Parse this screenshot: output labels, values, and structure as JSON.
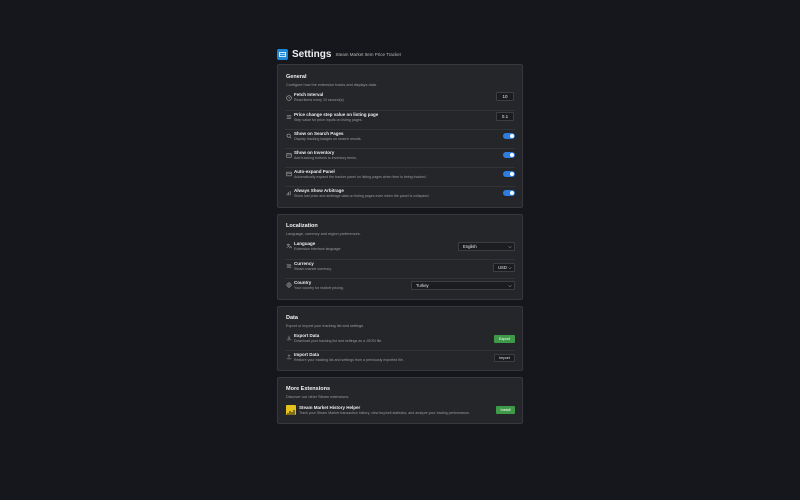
{
  "header": {
    "title": "Settings",
    "subtitle": "Steam Market Item Price Tracker"
  },
  "general": {
    "title": "General",
    "desc": "Configure how the extension tracks and displays data.",
    "rows": [
      {
        "label": "Fetch Interval",
        "desc": "Read items every 10 second(s)",
        "value": "10",
        "icon": "clock-icon"
      },
      {
        "label": "Price change step value on listing page",
        "desc": "Step value for price inputs on listing pages.",
        "value": "0.1",
        "icon": "list-icon"
      },
      {
        "label": "Show on Search Pages",
        "desc": "Display tracking badges on search results.",
        "toggle": true,
        "icon": "search-icon"
      },
      {
        "label": "Show on Inventory",
        "desc": "Add tracking buttons to inventory items.",
        "toggle": true,
        "icon": "inventory-icon"
      },
      {
        "label": "Auto-expand Panel",
        "desc": "Automatically expand the tracker panel on listing pages when item is being tracked.",
        "toggle": true,
        "icon": "panel-icon"
      },
      {
        "label": "Always Show Arbitrage",
        "desc": "Show lost price and arbitrage data on listing pages even when the panel is collapsed.",
        "toggle": true,
        "icon": "chart-icon"
      }
    ]
  },
  "localization": {
    "title": "Localization",
    "desc": "Language, currency and region preferences.",
    "rows": [
      {
        "label": "Language",
        "desc": "Extension interface language.",
        "value": "English",
        "icon": "language-icon"
      },
      {
        "label": "Currency",
        "desc": "Steam market currency.",
        "value": "USD",
        "icon": "currency-icon"
      },
      {
        "label": "Country",
        "desc": "Your country for market pricing.",
        "value": "Turkey",
        "icon": "globe-icon"
      }
    ]
  },
  "data": {
    "title": "Data",
    "desc": "Export or import your tracking list and settings.",
    "rows": [
      {
        "label": "Export Data",
        "desc": "Download your tracking list and settings as a JSON file.",
        "button": "Export",
        "icon": "download-icon"
      },
      {
        "label": "Import Data",
        "desc": "Restore your tracking list and settings from a previously exported file.",
        "button": "Import",
        "icon": "upload-icon"
      }
    ]
  },
  "extensions": {
    "title": "More Extensions",
    "desc": "Discover our other Steam extensions.",
    "item": {
      "label": "Steam Market History Helper",
      "desc": "Track your Steam Market transaction history, view buy/sell statistics, and analyze your trading performance.",
      "button": "Install"
    }
  },
  "colors": {
    "background": "#15171c",
    "card": "#25262a",
    "accent": "#2d7ee0",
    "green": "#3e9a48",
    "logo": "#1e88d6",
    "ext_logo": "#e5c21b"
  }
}
